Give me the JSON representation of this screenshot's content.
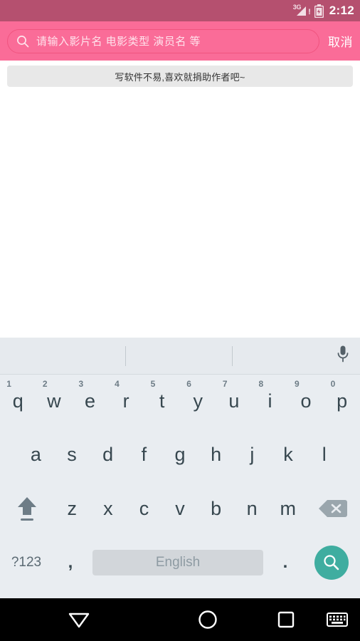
{
  "status_bar": {
    "network_label": "3G",
    "network_alert": "!",
    "time": "2:12",
    "background_color": "#b5506f",
    "icons": [
      "signal-icon",
      "battery-icon"
    ]
  },
  "header": {
    "background_color": "#fa6c98",
    "search": {
      "placeholder": "请输入影片名 电影类型 演员名 等",
      "value": "",
      "icon": "search-icon"
    },
    "cancel_label": "取消"
  },
  "banner": {
    "text": "写软件不易,喜欢就捐助作者吧~",
    "background_color": "#e8e8e8"
  },
  "content": {
    "items": [],
    "background_color": "#ffffff"
  },
  "keyboard": {
    "background_color": "#e9edf1",
    "suggestion_bar": {
      "suggestions": [
        "",
        "",
        ""
      ],
      "mic_icon": "microphone-icon"
    },
    "row1": [
      {
        "letter": "q",
        "num": "1"
      },
      {
        "letter": "w",
        "num": "2"
      },
      {
        "letter": "e",
        "num": "3"
      },
      {
        "letter": "r",
        "num": "4"
      },
      {
        "letter": "t",
        "num": "5"
      },
      {
        "letter": "y",
        "num": "6"
      },
      {
        "letter": "u",
        "num": "7"
      },
      {
        "letter": "i",
        "num": "8"
      },
      {
        "letter": "o",
        "num": "9"
      },
      {
        "letter": "p",
        "num": "0"
      }
    ],
    "row2": [
      {
        "letter": "a"
      },
      {
        "letter": "s"
      },
      {
        "letter": "d"
      },
      {
        "letter": "f"
      },
      {
        "letter": "g"
      },
      {
        "letter": "h"
      },
      {
        "letter": "j"
      },
      {
        "letter": "k"
      },
      {
        "letter": "l"
      }
    ],
    "row3": {
      "shift_icon": "shift-icon",
      "letters": [
        {
          "letter": "z"
        },
        {
          "letter": "x"
        },
        {
          "letter": "c"
        },
        {
          "letter": "v"
        },
        {
          "letter": "b"
        },
        {
          "letter": "n"
        },
        {
          "letter": "m"
        }
      ],
      "delete_icon": "backspace-icon"
    },
    "row4": {
      "symbols_label": "?123",
      "comma_label": ",",
      "space_label": "English",
      "period_label": ".",
      "enter_icon": "search-icon",
      "enter_color": "#3fada0"
    }
  },
  "navbar": {
    "background_color": "#000000",
    "buttons": [
      {
        "name": "back-button",
        "icon": "triangle-down-icon"
      },
      {
        "name": "home-button",
        "icon": "circle-icon"
      },
      {
        "name": "recents-button",
        "icon": "square-icon"
      },
      {
        "name": "keyboard-switch-button",
        "icon": "keyboard-icon"
      }
    ]
  }
}
